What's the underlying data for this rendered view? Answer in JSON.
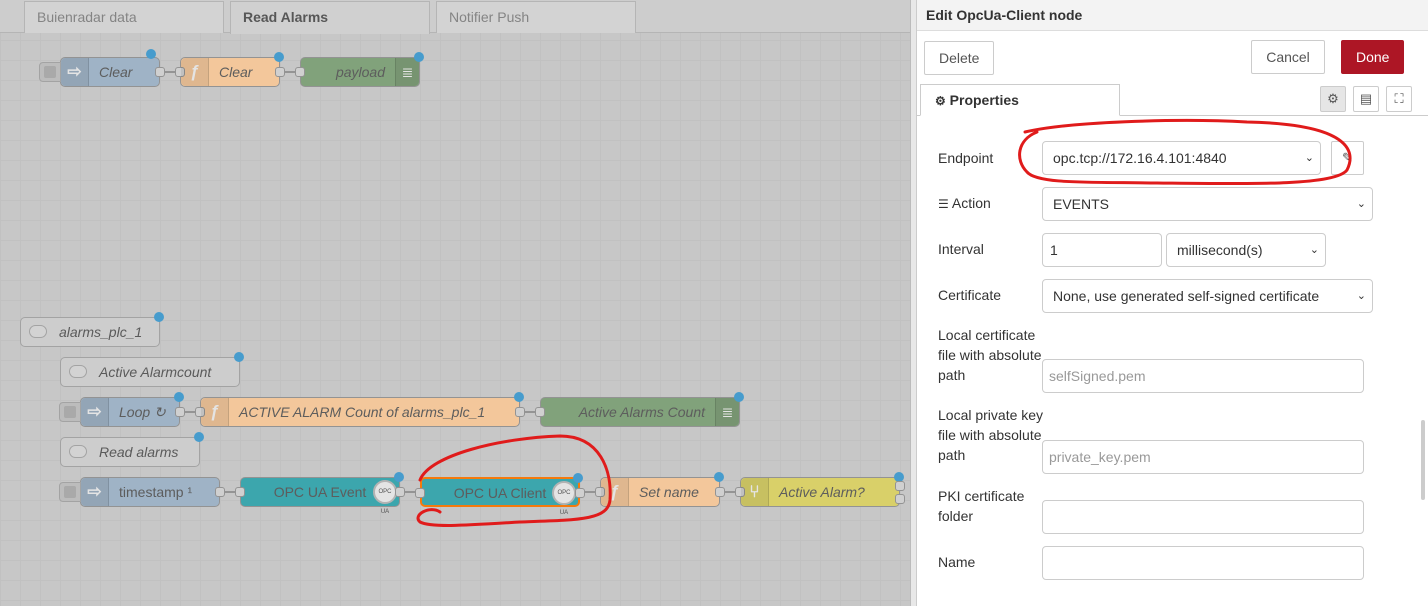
{
  "tabs": [
    {
      "label": "Buienradar data"
    },
    {
      "label": "Read Alarms"
    },
    {
      "label": "Notifier Push"
    }
  ],
  "flow": {
    "row1": {
      "inject": "Clear",
      "function": "Clear",
      "debug": "payload"
    },
    "comment1": "alarms_plc_1",
    "comment2": "Active Alarmcount",
    "row2": {
      "inject": "Loop ↻",
      "function": "ACTIVE ALARM Count of alarms_plc_1",
      "debug": "Active Alarms Count"
    },
    "comment3": "Read alarms",
    "row3": {
      "inject": "timestamp ¹",
      "event": "OPC UA Event",
      "client": "OPC UA Client",
      "function": "Set name",
      "switch": "Active Alarm?"
    },
    "badge": "OPC UA"
  },
  "tray": {
    "title": "Edit OpcUa-Client node",
    "delete_label": "Delete",
    "cancel_label": "Cancel",
    "done_label": "Done",
    "properties_tab": "Properties",
    "fields": {
      "endpoint_label": "Endpoint",
      "endpoint_value": "opc.tcp://172.16.4.101:4840",
      "action_label": "Action",
      "action_value": "EVENTS",
      "interval_label": "Interval",
      "interval_value": "1",
      "interval_unit": "millisecond(s)",
      "certificate_label": "Certificate",
      "certificate_value": "None, use generated self-signed certificate",
      "local_cert_label": "Local certificate file with absolute path",
      "local_cert_placeholder": "selfSigned.pem",
      "local_key_label": "Local private key file with absolute path",
      "local_key_placeholder": "private_key.pem",
      "pki_label": "PKI certificate folder",
      "pki_value": "",
      "name_label": "Name",
      "name_value": ""
    }
  },
  "colors": {
    "done": "#ad1625",
    "annotation": "#e01b1b",
    "node_blue": "#a6bbcf",
    "node_orange": "#fdd0a2",
    "node_green": "#87a980",
    "node_teal": "#3fadb5",
    "node_yellow": "#e2d96e"
  }
}
